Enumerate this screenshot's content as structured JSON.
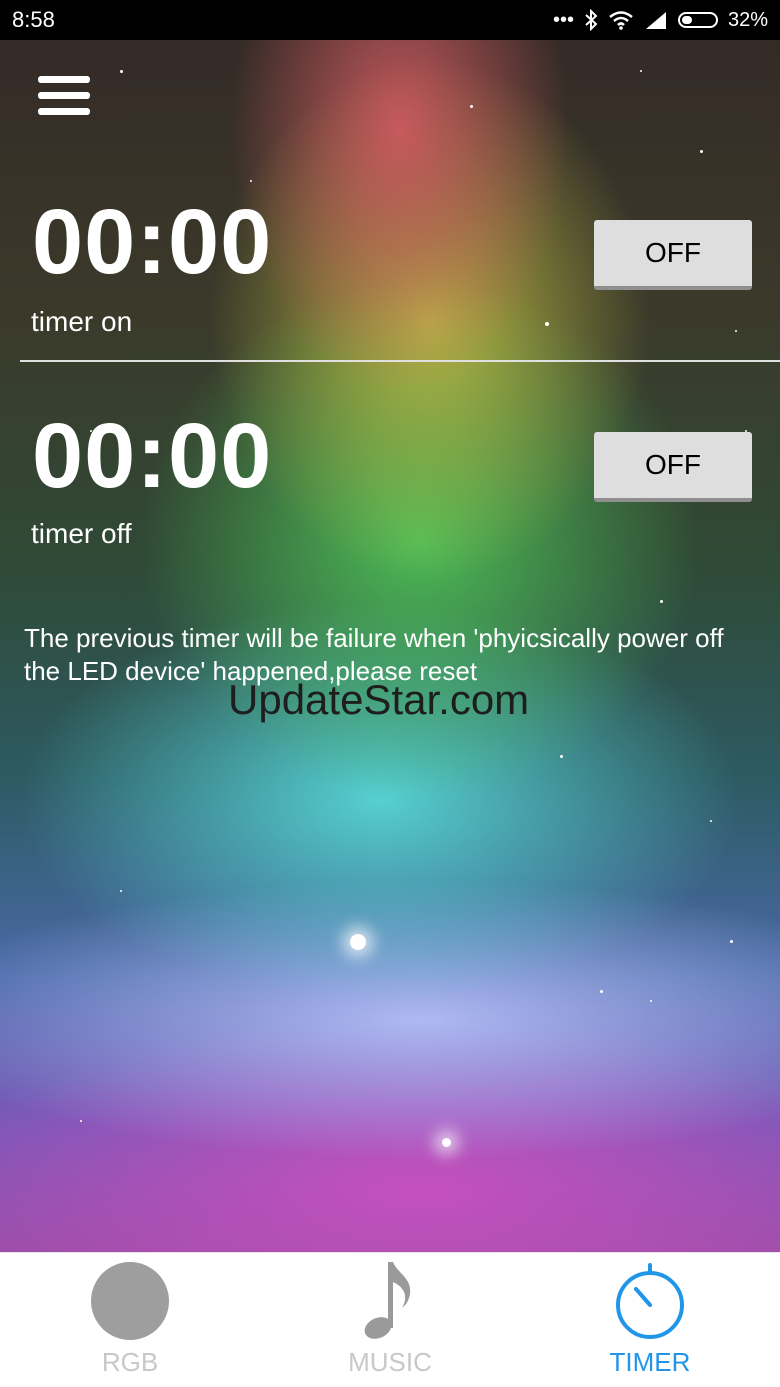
{
  "status_bar": {
    "time": "8:58",
    "battery": "32%",
    "battery_level": 0.32
  },
  "timers": [
    {
      "value": "00:00",
      "label": "timer on",
      "button": "OFF"
    },
    {
      "value": "00:00",
      "label": "timer off",
      "button": "OFF"
    }
  ],
  "warning_text": "The previous timer will be failure when 'phyicsically power off the LED device' happened,please reset",
  "watermark": "UpdateStar.com",
  "nav": {
    "items": [
      {
        "label": "RGB",
        "icon": "circle-icon"
      },
      {
        "label": "MUSIC",
        "icon": "music-note-icon"
      },
      {
        "label": "TIMER",
        "icon": "timer-icon"
      }
    ],
    "active": "TIMER"
  },
  "colors": {
    "accent": "#2196e8",
    "inactive": "#c8c8c8",
    "button_bg": "#dedede"
  }
}
